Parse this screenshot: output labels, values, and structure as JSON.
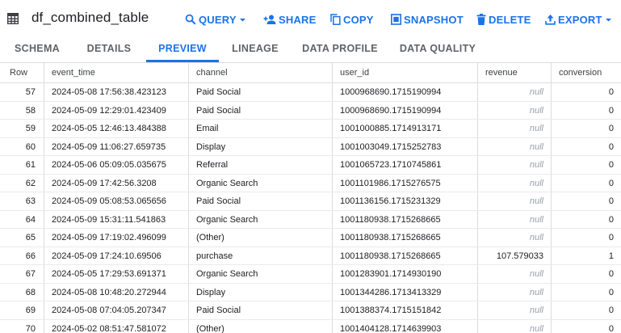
{
  "header": {
    "title": "df_combined_table",
    "actions": {
      "query": "QUERY",
      "share": "SHARE",
      "copy": "COPY",
      "snapshot": "SNAPSHOT",
      "delete": "DELETE",
      "export": "EXPORT"
    }
  },
  "tabs": [
    "SCHEMA",
    "DETAILS",
    "PREVIEW",
    "LINEAGE",
    "DATA PROFILE",
    "DATA QUALITY"
  ],
  "active_tab": "PREVIEW",
  "colors": {
    "accent": "#1a73e8",
    "text": "#202124",
    "muted": "#5f6368",
    "divider": "#dadce0"
  },
  "table": {
    "columns": [
      "Row",
      "event_time",
      "channel",
      "user_id",
      "revenue",
      "conversion"
    ],
    "rows": [
      [
        "57",
        "2024-05-08 17:56:38.423123",
        "Paid Social",
        "1000968690.1715190994",
        "null",
        "0"
      ],
      [
        "58",
        "2024-05-09 12:29:01.423409",
        "Paid Social",
        "1000968690.1715190994",
        "null",
        "0"
      ],
      [
        "59",
        "2024-05-05 12:46:13.484388",
        "Email",
        "1001000885.1714913171",
        "null",
        "0"
      ],
      [
        "60",
        "2024-05-09 11:06:27.659735",
        "Display",
        "1001003049.1715252783",
        "null",
        "0"
      ],
      [
        "61",
        "2024-05-06 05:09:05.035675",
        "Referral",
        "1001065723.1710745861",
        "null",
        "0"
      ],
      [
        "62",
        "2024-05-09 17:42:56.3208",
        "Organic Search",
        "1001101986.1715276575",
        "null",
        "0"
      ],
      [
        "63",
        "2024-05-09 05:08:53.065656",
        "Paid Social",
        "1001136156.1715231329",
        "null",
        "0"
      ],
      [
        "64",
        "2024-05-09 15:31:11.541863",
        "Organic Search",
        "1001180938.1715268665",
        "null",
        "0"
      ],
      [
        "65",
        "2024-05-09 17:19:02.496099",
        "(Other)",
        "1001180938.1715268665",
        "null",
        "0"
      ],
      [
        "66",
        "2024-05-09 17:24:10.69506",
        "purchase",
        "1001180938.1715268665",
        "107.579033",
        "1"
      ],
      [
        "67",
        "2024-05-05 17:29:53.691371",
        "Organic Search",
        "1001283901.1714930190",
        "null",
        "0"
      ],
      [
        "68",
        "2024-05-08 10:48:20.272944",
        "Display",
        "1001344286.1713413329",
        "null",
        "0"
      ],
      [
        "69",
        "2024-05-08 07:04:05.207347",
        "Paid Social",
        "1001388374.1715151842",
        "null",
        "0"
      ],
      [
        "70",
        "2024-05-02 08:51:47.581072",
        "(Other)",
        "1001404128.1714639903",
        "null",
        "0"
      ]
    ]
  }
}
